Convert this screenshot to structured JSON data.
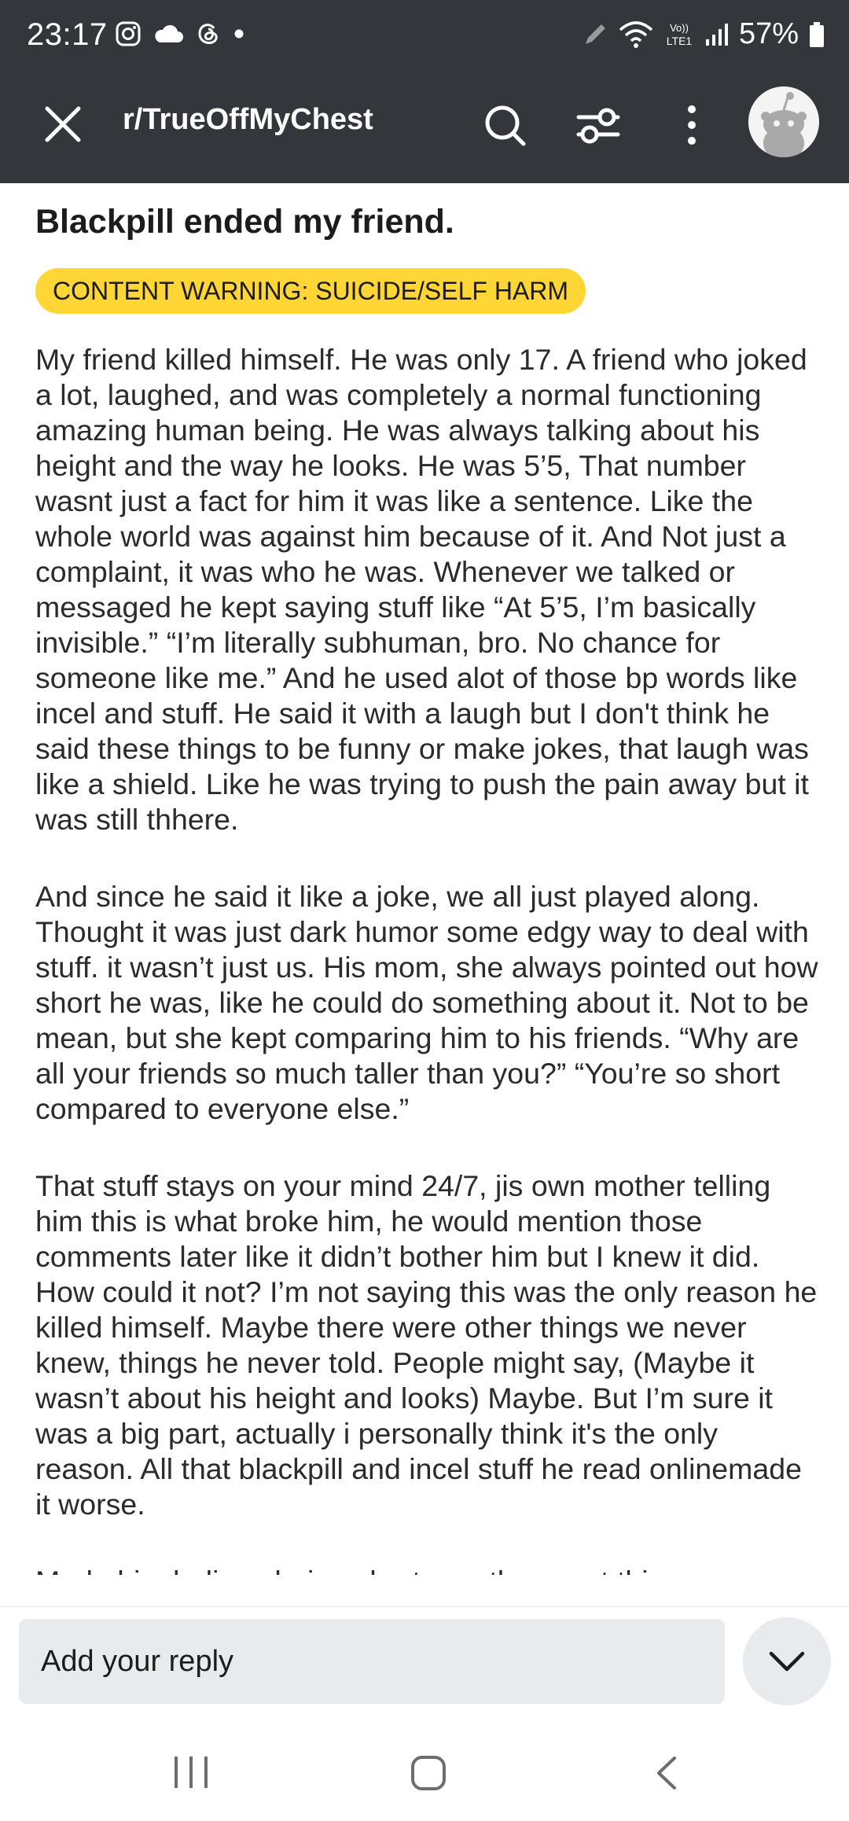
{
  "status_bar": {
    "time": "23:17",
    "battery": "57%",
    "network": "LTE1"
  },
  "header": {
    "subreddit": "r/TrueOffMyChest",
    "icons": [
      "close-icon",
      "search-icon",
      "filter-icon",
      "more-icon",
      "avatar"
    ]
  },
  "post": {
    "title": "Blackpill ended my friend.",
    "content_warning": "CONTENT WARNING: SUICIDE/SELF HARM",
    "paragraphs": [
      "My friend killed himself. He was only 17. A friend who joked a lot, laughed, and was completely a normal functioning amazing human being. He was always talking about his height and the way he looks. He was 5’5, That number wasnt just a fact for him it was like a sentence. Like the whole world was against him because of it. And Not just a complaint, it was who he was. Whenever we talked or messaged he kept saying stuff like “At 5’5, I’m basically invisible.” “I’m literally subhuman, bro. No chance for someone like me.” And he used alot of those bp words like incel and stuff. He said it with a laugh but I don't think he said these things to be funny or make jokes, that laugh was like a shield. Like he was trying to push the pain away but it was still thhere.",
      "And since he said it like a joke, we all just played along. Thought it was just dark humor some edgy way to deal with stuff. it wasn’t just us. His mom, she always pointed out how short he was, like he could do something about it. Not to be mean, but she kept comparing him to his friends. “Why are all your friends so much taller than you?” “You’re so short compared to everyone else.”",
      "That stuff stays on your mind 24/7, jis own mother telling him this is what broke him, he would mention those comments later like it didn’t bother him but I knew it did. How could it not? I’m not saying this was the only reason he killed himself. Maybe there were other things we never knew, things he never told. People might say, (Maybe it wasn’t about his height and looks) Maybe. But I’m sure it was a big part, actually i personally think it's the only reason. All that blackpill and incel stuff he read onlinemade it worse.",
      "Made him believe being short was the worst thing you"
    ]
  },
  "reply": {
    "placeholder": "Add your reply"
  },
  "colors": {
    "header_bg": "#33373b",
    "badge_bg": "#ffd635",
    "input_bg": "#e8ebee"
  }
}
